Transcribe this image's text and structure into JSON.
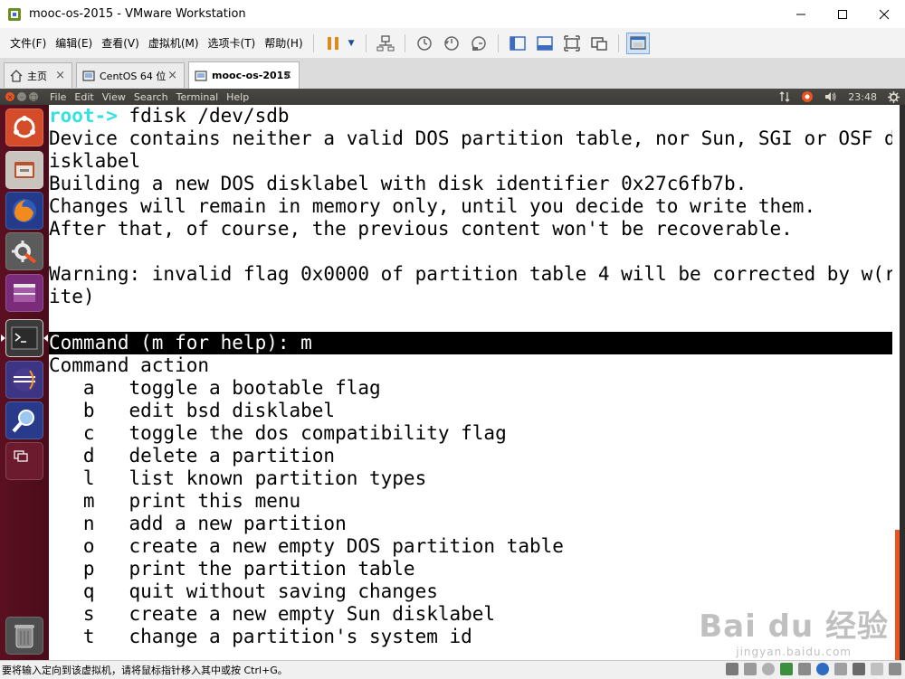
{
  "window": {
    "title": "mooc-os-2015 - VMware Workstation",
    "controls": [
      "minimize",
      "maximize",
      "close"
    ]
  },
  "menubar": {
    "items": [
      "文件(F)",
      "编辑(E)",
      "查看(V)",
      "虚拟机(M)",
      "选项卡(T)",
      "帮助(H)"
    ]
  },
  "tabs": [
    {
      "label": "主页",
      "icon": "home-icon",
      "close": "×"
    },
    {
      "label": "CentOS 64 位",
      "icon": "vm-icon",
      "close": "×"
    },
    {
      "label": "mooc-os-2015",
      "icon": "vm-icon",
      "close": "×",
      "active": true
    }
  ],
  "guest_panel": {
    "menus": [
      "File",
      "Edit",
      "View",
      "Search",
      "Terminal",
      "Help"
    ],
    "clock": "23:48"
  },
  "terminal": {
    "prompt": "root->",
    "lines": [
      {
        "prompt": "root->",
        "text": " fdisk /dev/sdb"
      },
      {
        "text": "Device contains neither a valid DOS partition table, nor Sun, SGI or OSF d"
      },
      {
        "text": "isklabel"
      },
      {
        "text": "Building a new DOS disklabel with disk identifier 0x27c6fb7b."
      },
      {
        "text": "Changes will remain in memory only, until you decide to write them."
      },
      {
        "text": "After that, of course, the previous content won't be recoverable."
      },
      {
        "text": ""
      },
      {
        "text": "Warning: invalid flag 0x0000 of partition table 4 will be corrected by w(r"
      },
      {
        "text": "ite)"
      },
      {
        "text": ""
      },
      {
        "text": "Command (m for help): m",
        "highlight": true
      },
      {
        "text": "Command action"
      },
      {
        "text": "   a   toggle a bootable flag"
      },
      {
        "text": "   b   edit bsd disklabel"
      },
      {
        "text": "   c   toggle the dos compatibility flag"
      },
      {
        "text": "   d   delete a partition"
      },
      {
        "text": "   l   list known partition types"
      },
      {
        "text": "   m   print this menu"
      },
      {
        "text": "   n   add a new partition"
      },
      {
        "text": "   o   create a new empty DOS partition table"
      },
      {
        "text": "   p   print the partition table"
      },
      {
        "text": "   q   quit without saving changes"
      },
      {
        "text": "   s   create a new empty Sun disklabel"
      },
      {
        "text": "   t   change a partition's system id"
      }
    ]
  },
  "watermark": {
    "main": "Bai du 经验",
    "sub": "jingyan.baidu.com"
  },
  "statusbar": {
    "text": "要将输入定向到该虚拟机，请将鼠标指针移入其中或按 Ctrl+G。"
  },
  "colors": {
    "prompt": "#34e2e2",
    "launcher": "#5b1021",
    "ubuntu_orange": "#e95420",
    "panel": "#3c3b37"
  }
}
